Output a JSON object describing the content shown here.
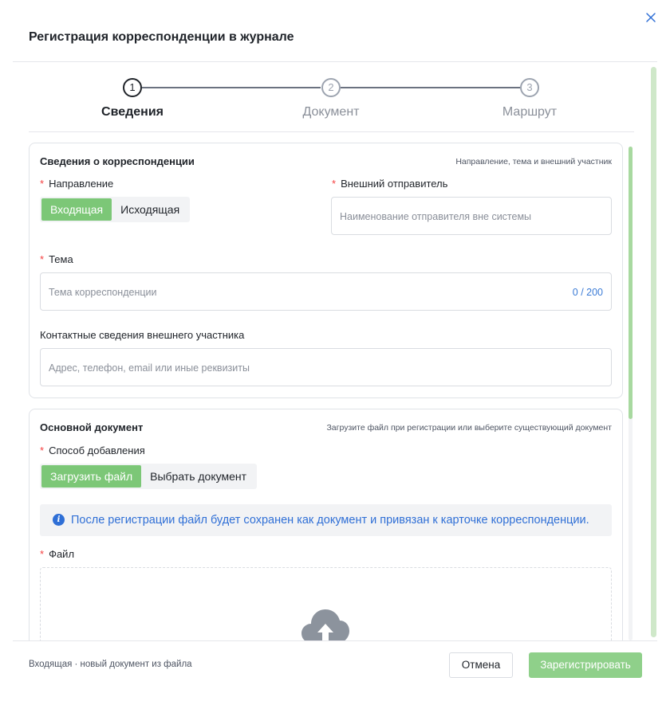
{
  "dialog": {
    "title": "Регистрация корреспонденции в журнале"
  },
  "steps": [
    {
      "number": "1",
      "label": "Сведения",
      "active": true
    },
    {
      "number": "2",
      "label": "Документ",
      "active": false
    },
    {
      "number": "3",
      "label": "Маршрут",
      "active": false
    }
  ],
  "correspondence": {
    "title": "Сведения о корреспонденции",
    "hint": "Направление, тема и внешний участник",
    "direction": {
      "required_mark": "*",
      "label": "Направление",
      "options": [
        "Входящая",
        "Исходящая"
      ],
      "selected": "Входящая"
    },
    "sender": {
      "required_mark": "*",
      "label": "Внешний отправитель",
      "placeholder": "Наименование отправителя вне системы",
      "value": ""
    },
    "subject": {
      "required_mark": "*",
      "label": "Тема",
      "placeholder": "Тема корреспонденции",
      "value": "",
      "counter": "0 / 200"
    },
    "contacts": {
      "label": "Контактные сведения внешнего участника",
      "placeholder": "Адрес, телефон, email или иные реквизиты",
      "value": ""
    }
  },
  "document": {
    "title": "Основной документ",
    "hint": "Загрузите файл при регистрации или выберите существующий документ",
    "method": {
      "required_mark": "*",
      "label": "Способ добавления",
      "options": [
        "Загрузить файл",
        "Выбрать документ"
      ],
      "selected": "Загрузить файл"
    },
    "info": {
      "icon": "info-icon",
      "text": "После регистрации файл будет сохранен как документ и привязан к карточке корреспонденции."
    },
    "file": {
      "required_mark": "*",
      "label": "Файл",
      "icon": "upload-cloud-icon"
    }
  },
  "footer": {
    "note": "Входящая · новый документ из файла",
    "cancel_label": "Отмена",
    "submit_label": "Зарегистрировать"
  },
  "colors": {
    "accent_green": "#7cc777",
    "submit_green": "#8fd08a",
    "info_blue": "#2f6fd6",
    "required_red": "#f53f3f"
  }
}
